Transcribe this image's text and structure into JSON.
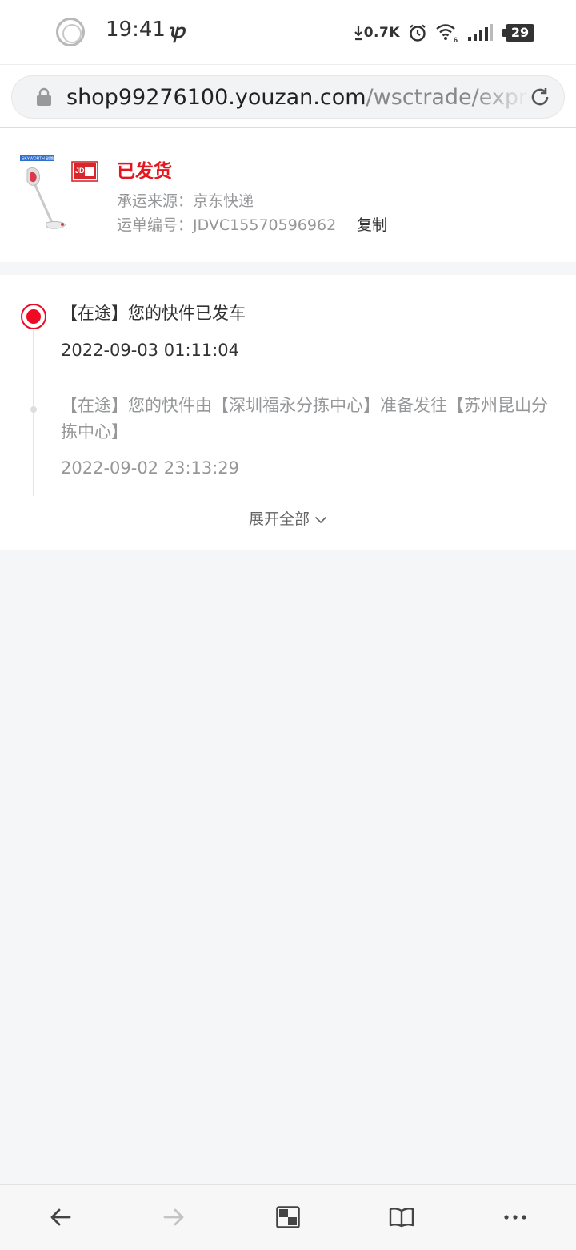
{
  "status_bar": {
    "time": "19:41",
    "carrier_glyph": "ꝕ",
    "net_speed": "0.7K",
    "battery": "29",
    "icons": [
      "record-circle-icon",
      "download-arrow-icon",
      "alarm-clock-icon",
      "wifi-icon",
      "signal-bars-icon",
      "battery-icon"
    ]
  },
  "browser": {
    "url_host": "shop99276100.youzan.com",
    "url_path": "/wsctrade/express"
  },
  "shipment": {
    "status": "已发货",
    "carrier_label": "承运来源：",
    "carrier": "京东快递",
    "tracking_label": "运单编号：",
    "tracking_number": "JDVC15570596962",
    "copy_label": "复制",
    "thumb_brand": "SKYWORTH 创维",
    "thumb_jd": "JD"
  },
  "tracking": {
    "events": [
      {
        "text": "【在途】您的快件已发车",
        "time": "2022-09-03 01:11:04"
      },
      {
        "text": "【在途】您的快件由【深圳福永分拣中心】准备发往【苏州昆山分拣中心】",
        "time": "2022-09-02 23:13:29"
      }
    ],
    "expand_label": "展开全部"
  },
  "colors": {
    "accent_red": "#ee0a24",
    "status_red": "#e4161f",
    "muted_text": "#969799",
    "page_bg": "#f5f6f8"
  }
}
